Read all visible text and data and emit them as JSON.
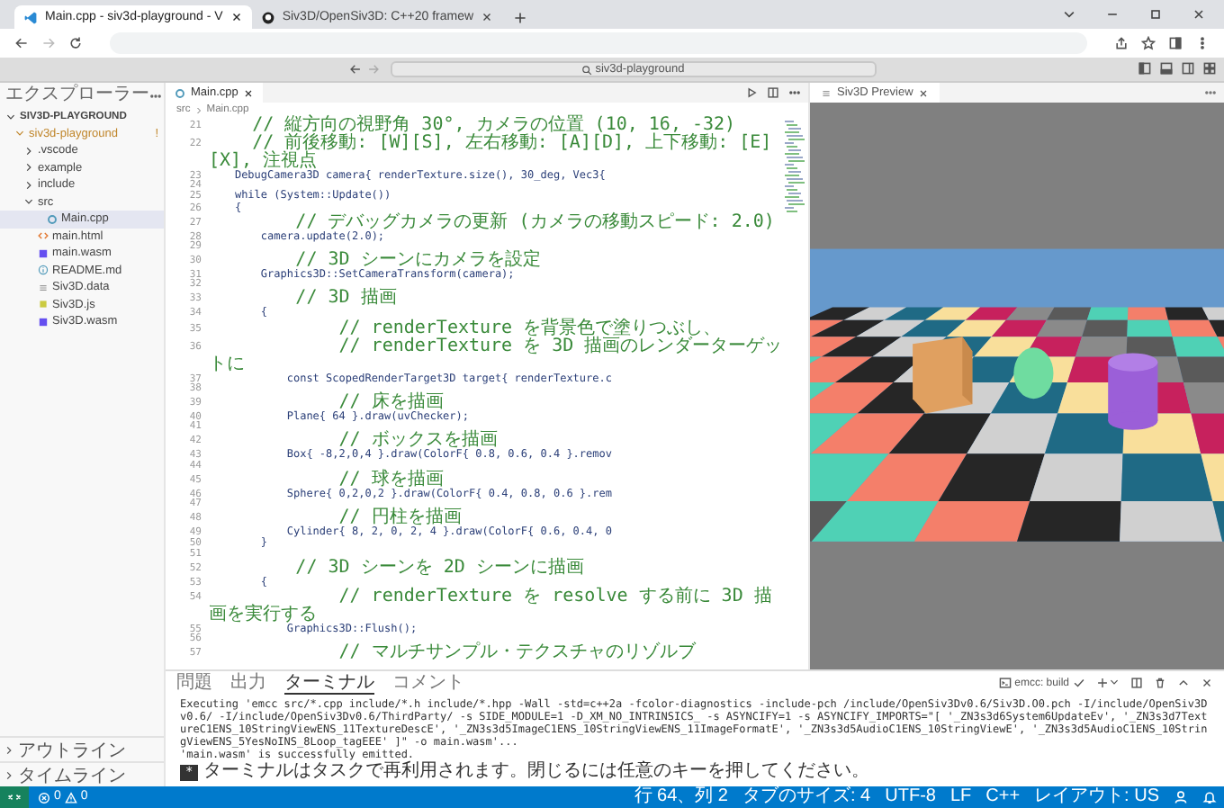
{
  "browser": {
    "tabs": [
      {
        "kind": "vscode",
        "title": "Main.cpp - siv3d-playground - V",
        "selected": true
      },
      {
        "kind": "github",
        "title": "Siv3D/OpenSiv3D: C++20 framew",
        "selected": false
      }
    ]
  },
  "titlebar": {
    "search": {
      "label": "siv3d-playground"
    }
  },
  "explorer": {
    "title": "エクスプローラー",
    "tree": [
      {
        "kind": "folder",
        "label": "SIV3D-PLAYGROUND",
        "expanded": true,
        "selected": false,
        "children": [
          {
            "kind": "folder",
            "label": "siv3d-playground",
            "badge": "!",
            "expanded": true,
            "selected": false,
            "children": [
              {
                "kind": "folder",
                "label": ".vscode",
                "expanded": false,
                "selected": false
              },
              {
                "kind": "folder",
                "label": "example",
                "expanded": false,
                "selected": false
              },
              {
                "kind": "folder",
                "label": "include",
                "expanded": false,
                "selected": false
              },
              {
                "kind": "folder",
                "label": "src",
                "expanded": true,
                "selected": false,
                "children": [
                  {
                    "kind": "cpp",
                    "label": "Main.cpp",
                    "selected": true
                  }
                ]
              },
              {
                "kind": "html",
                "label": "main.html",
                "selected": false
              },
              {
                "kind": "wasm",
                "label": "main.wasm",
                "selected": false
              },
              {
                "kind": "md",
                "label": "README.md",
                "selected": false
              },
              {
                "kind": "data",
                "label": "Siv3D.data",
                "selected": false
              },
              {
                "kind": "js",
                "label": "Siv3D.js",
                "selected": false
              },
              {
                "kind": "wasm",
                "label": "Siv3D.wasm",
                "selected": false
              }
            ]
          }
        ]
      }
    ],
    "sections": [
      {
        "label": "アウトライン",
        "expanded": false
      },
      {
        "label": "タイムライン",
        "expanded": false
      }
    ]
  },
  "editor": {
    "tabs": [
      {
        "label": "Main.cpp",
        "selected": true
      }
    ],
    "breadcrumb": [
      "src",
      "Main.cpp"
    ],
    "lines": [
      {
        "number": "21",
        "kind": "comment",
        "text": "    // 縦方向の視野角 30°, カメラの位置 (10, 16, -32)"
      },
      {
        "number": "22",
        "kind": "comment",
        "text": "    // 前後移動: [W][S], 左右移動: [A][D], 上下移動: [E][X], 注視点"
      },
      {
        "number": "23",
        "kind": "code",
        "text": "    DebugCamera3D camera{ renderTexture.size(), 30_deg, Vec3{"
      },
      {
        "number": "24",
        "kind": "blank"
      },
      {
        "number": "25",
        "kind": "code",
        "text": "    while (System::Update())"
      },
      {
        "number": "26",
        "kind": "code",
        "text": "    {"
      },
      {
        "number": "27",
        "kind": "comment",
        "text": "        // デバッグカメラの更新 (カメラの移動スピード: 2.0)"
      },
      {
        "number": "28",
        "kind": "code",
        "text": "        camera.update(2.0);"
      },
      {
        "number": "29",
        "kind": "blank"
      },
      {
        "number": "30",
        "kind": "comment",
        "text": "        // 3D シーンにカメラを設定"
      },
      {
        "number": "31",
        "kind": "code",
        "text": "        Graphics3D::SetCameraTransform(camera);"
      },
      {
        "number": "32",
        "kind": "blank"
      },
      {
        "number": "33",
        "kind": "comment",
        "text": "        // 3D 描画"
      },
      {
        "number": "34",
        "kind": "code",
        "text": "        {"
      },
      {
        "number": "35",
        "kind": "comment",
        "text": "            // renderTexture を背景色で塗りつぶし、"
      },
      {
        "number": "36",
        "kind": "comment",
        "text": "            // renderTexture を 3D 描画のレンダーターゲットに"
      },
      {
        "number": "37",
        "kind": "code",
        "text": "            const ScopedRenderTarget3D target{ renderTexture.c"
      },
      {
        "number": "38",
        "kind": "blank"
      },
      {
        "number": "39",
        "kind": "comment",
        "text": "            // 床を描画"
      },
      {
        "number": "40",
        "kind": "code",
        "text": "            Plane{ 64 }.draw(uvChecker);"
      },
      {
        "number": "41",
        "kind": "blank"
      },
      {
        "number": "42",
        "kind": "comment",
        "text": "            // ボックスを描画"
      },
      {
        "number": "43",
        "kind": "code",
        "text": "            Box{ -8,2,0,4 }.draw(ColorF{ 0.8, 0.6, 0.4 }.remov"
      },
      {
        "number": "44",
        "kind": "blank"
      },
      {
        "number": "45",
        "kind": "comment",
        "text": "            // 球を描画"
      },
      {
        "number": "46",
        "kind": "code",
        "text": "            Sphere{ 0,2,0,2 }.draw(ColorF{ 0.4, 0.8, 0.6 }.rem"
      },
      {
        "number": "47",
        "kind": "blank"
      },
      {
        "number": "48",
        "kind": "comment",
        "text": "            // 円柱を描画"
      },
      {
        "number": "49",
        "kind": "code",
        "text": "            Cylinder{ 8, 2, 0, 2, 4 }.draw(ColorF{ 0.6, 0.4, 0"
      },
      {
        "number": "50",
        "kind": "code",
        "text": "        }"
      },
      {
        "number": "51",
        "kind": "blank"
      },
      {
        "number": "52",
        "kind": "comment",
        "text": "        // 3D シーンを 2D シーンに描画"
      },
      {
        "number": "53",
        "kind": "code",
        "text": "        {"
      },
      {
        "number": "54",
        "kind": "comment",
        "text": "            // renderTexture を resolve する前に 3D 描画を実行する"
      },
      {
        "number": "55",
        "kind": "code",
        "text": "            Graphics3D::Flush();"
      },
      {
        "number": "56",
        "kind": "blank"
      },
      {
        "number": "57",
        "kind": "comment",
        "text": "            // マルチサンプル・テクスチャのリゾルブ"
      }
    ]
  },
  "preview": {
    "tabs": [
      {
        "label": "Siv3D Preview",
        "selected": true
      }
    ]
  },
  "panel": {
    "tabs": [
      {
        "label": "問題",
        "selected": false
      },
      {
        "label": "出力",
        "selected": false
      },
      {
        "label": "ターミナル",
        "selected": true
      },
      {
        "label": "コメント",
        "selected": false
      }
    ],
    "task": "emcc: build",
    "lines": [
      {
        "kind": "command",
        "text": "Executing 'emcc src/*.cpp include/*.h include/*.hpp -Wall -std=c++2a -fcolor-diagnostics -include-pch /include/OpenSiv3Dv0.6/Siv3D.O0.pch -I/include/OpenSiv3Dv0.6/ -I/include/OpenSiv3Dv0.6/ThirdParty/ -s SIDE_MODULE=1 -D_XM_NO_INTRINSICS_ -s ASYNCIFY=1 -s ASYNCIFY_IMPORTS=\"[ '_ZN3s3d6System6UpdateEv', '_ZN3s3d7TextureC1ENS_10StringViewENS_11TextureDescE', '_ZN3s3d5ImageC1ENS_10StringViewENS_11ImageFormatE', '_ZN3s3d5AudioC1ENS_10StringViewE', '_ZN3s3d5AudioC1ENS_10StringViewENS_5YesNoINS_8Loop_tagEEE' ]\" -o main.wasm'..."
      },
      {
        "kind": "output",
        "text": "'main.wasm' is successfully emitted."
      },
      {
        "kind": "notice",
        "badge": "*",
        "text": "ターミナルはタスクで再利用されます。閉じるには任意のキーを押してください。"
      }
    ]
  },
  "status_bar": {
    "errors": "0",
    "warnings": "0",
    "items": [
      "行 64、列 2",
      "タブのサイズ: 4",
      "UTF-8",
      "LF",
      "C++",
      "レイアウト: US"
    ]
  }
}
